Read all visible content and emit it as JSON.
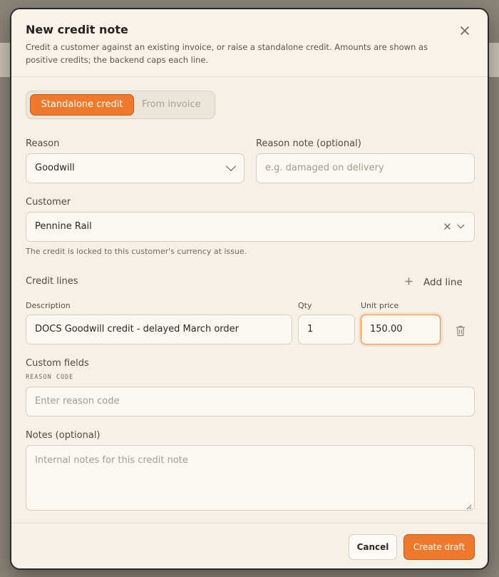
{
  "dialog": {
    "title": "New credit note",
    "description": "Credit a customer against an existing invoice, or raise a standalone credit. Amounts are shown as positive credits; the backend caps each line.",
    "close_icon": "close-icon"
  },
  "mode_toggle": {
    "options": [
      "Standalone credit",
      "From invoice"
    ],
    "selected": "Standalone credit"
  },
  "reason": {
    "label": "Reason",
    "value": "Goodwill"
  },
  "reason_note": {
    "label": "Reason note (optional)",
    "placeholder": "e.g. damaged on delivery"
  },
  "customer": {
    "label": "Customer",
    "value": "Pennine Rail",
    "hint": "The credit is locked to this customer's currency at issue."
  },
  "credit_lines": {
    "label": "Credit lines",
    "add_label": "Add line",
    "columns": [
      "Description",
      "Qty",
      "Unit price"
    ],
    "rows": [
      {
        "description": "DOCS Goodwill credit - delayed March order",
        "qty": "1",
        "unit_price": "150.00"
      }
    ]
  },
  "custom_fields": {
    "label": "Custom fields",
    "field_label": "REASON CODE",
    "placeholder": "Enter reason code"
  },
  "notes": {
    "label": "Notes (optional)",
    "placeholder": "Internal notes for this credit note"
  },
  "footer": {
    "cancel_label": "Cancel",
    "create_label": "Create draft"
  },
  "colors": {
    "accent": "#ef7a2b",
    "panel": "#f6f1e6",
    "border": "#d6cfc2"
  }
}
